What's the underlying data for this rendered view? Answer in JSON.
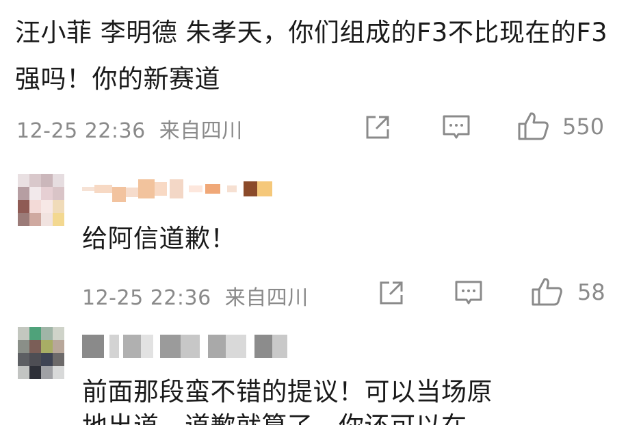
{
  "comment_main": {
    "text": "汪小菲 李明德 朱孝天，你们组成的F3不比现在的F3强吗！你的新赛道",
    "time": "12-25 22:36",
    "location": "来自四川",
    "likes": "550"
  },
  "reply_1": {
    "text": "给阿信道歉！",
    "time": "12-25 22:36",
    "location": "来自四川",
    "likes": "58"
  },
  "reply_2": {
    "text": "前面那段蛮不错的提议！可以当场原",
    "partial_text": "地出道，道歉就算了，你还可以在"
  },
  "icons": {
    "share": "share-icon",
    "comment": "comment-icon",
    "like": "thumbs-up-icon"
  },
  "colors": {
    "text": "#1a1a1a",
    "meta": "#8a8a8a",
    "background": "#ffffff"
  }
}
